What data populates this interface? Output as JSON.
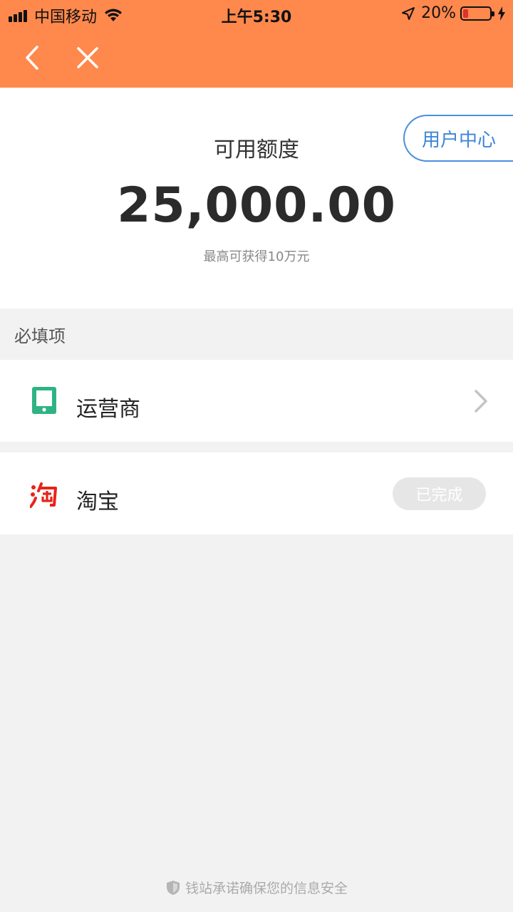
{
  "status_bar": {
    "carrier": "中国移动",
    "time": "上午5:30",
    "battery_percent": "20%",
    "battery_level": 0.2
  },
  "nav": {
    "back_icon": "chevron-left-icon",
    "close_icon": "close-icon"
  },
  "credit": {
    "label": "可用额度",
    "amount": "25,000.00",
    "hint": "最高可获得10万元",
    "user_center_label": "用户中心"
  },
  "required_section": {
    "title": "必填项",
    "items": [
      {
        "label": "运营商",
        "icon": "tablet-icon",
        "status": ""
      },
      {
        "label": "淘宝",
        "icon": "taobao-logo-icon",
        "status": "已完成"
      }
    ]
  },
  "footer": {
    "text": "钱站承诺确保您的信息安全"
  },
  "colors": {
    "header": "#ff884d",
    "accent_blue": "#3e86d8",
    "carrier_green": "#2fb384",
    "taobao_red": "#e8231a"
  }
}
